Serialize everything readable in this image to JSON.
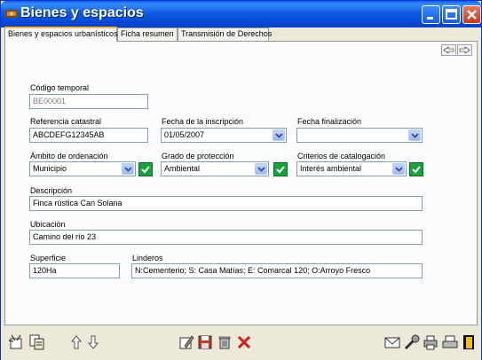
{
  "window": {
    "title": "Bienes y espacios"
  },
  "tabs": [
    {
      "label": "Bienes y espacios urbanísticos"
    },
    {
      "label": "Ficha resumen"
    },
    {
      "label": "Transmisión de Derechos"
    }
  ],
  "form": {
    "codigo_temporal": {
      "label": "Código temporal",
      "value": "BE00001"
    },
    "referencia_catastral": {
      "label": "Referencia catastral",
      "value": "ABCDEFG12345AB"
    },
    "fecha_inscripcion": {
      "label": "Fecha de la inscripción",
      "value": "01/05/2007"
    },
    "fecha_finalizacion": {
      "label": "Fecha finalización",
      "value": ""
    },
    "ambito_ordenacion": {
      "label": "Ámbito de ordenación",
      "value": "Municipio"
    },
    "grado_proteccion": {
      "label": "Grado de protección",
      "value": "Ambiental"
    },
    "criterios_catalogacion": {
      "label": "Criterios de catalogación",
      "value": "Interés ambiental"
    },
    "descripcion": {
      "label": "Descripción",
      "value": "Finca rústica Can Solana"
    },
    "ubicacion": {
      "label": "Ubicación",
      "value": "Camino del río 23"
    },
    "superficie": {
      "label": "Superficie",
      "value": "120Ha"
    },
    "linderos": {
      "label": "Linderos",
      "value": "N:Cementerio; S: Casa Matías; E: Comarcal 120; O:Arroyo Fresco"
    }
  },
  "colors": {
    "title_bar": "#0a5fe8",
    "check_green": "#17a23a",
    "close_red": "#c83a1c"
  }
}
